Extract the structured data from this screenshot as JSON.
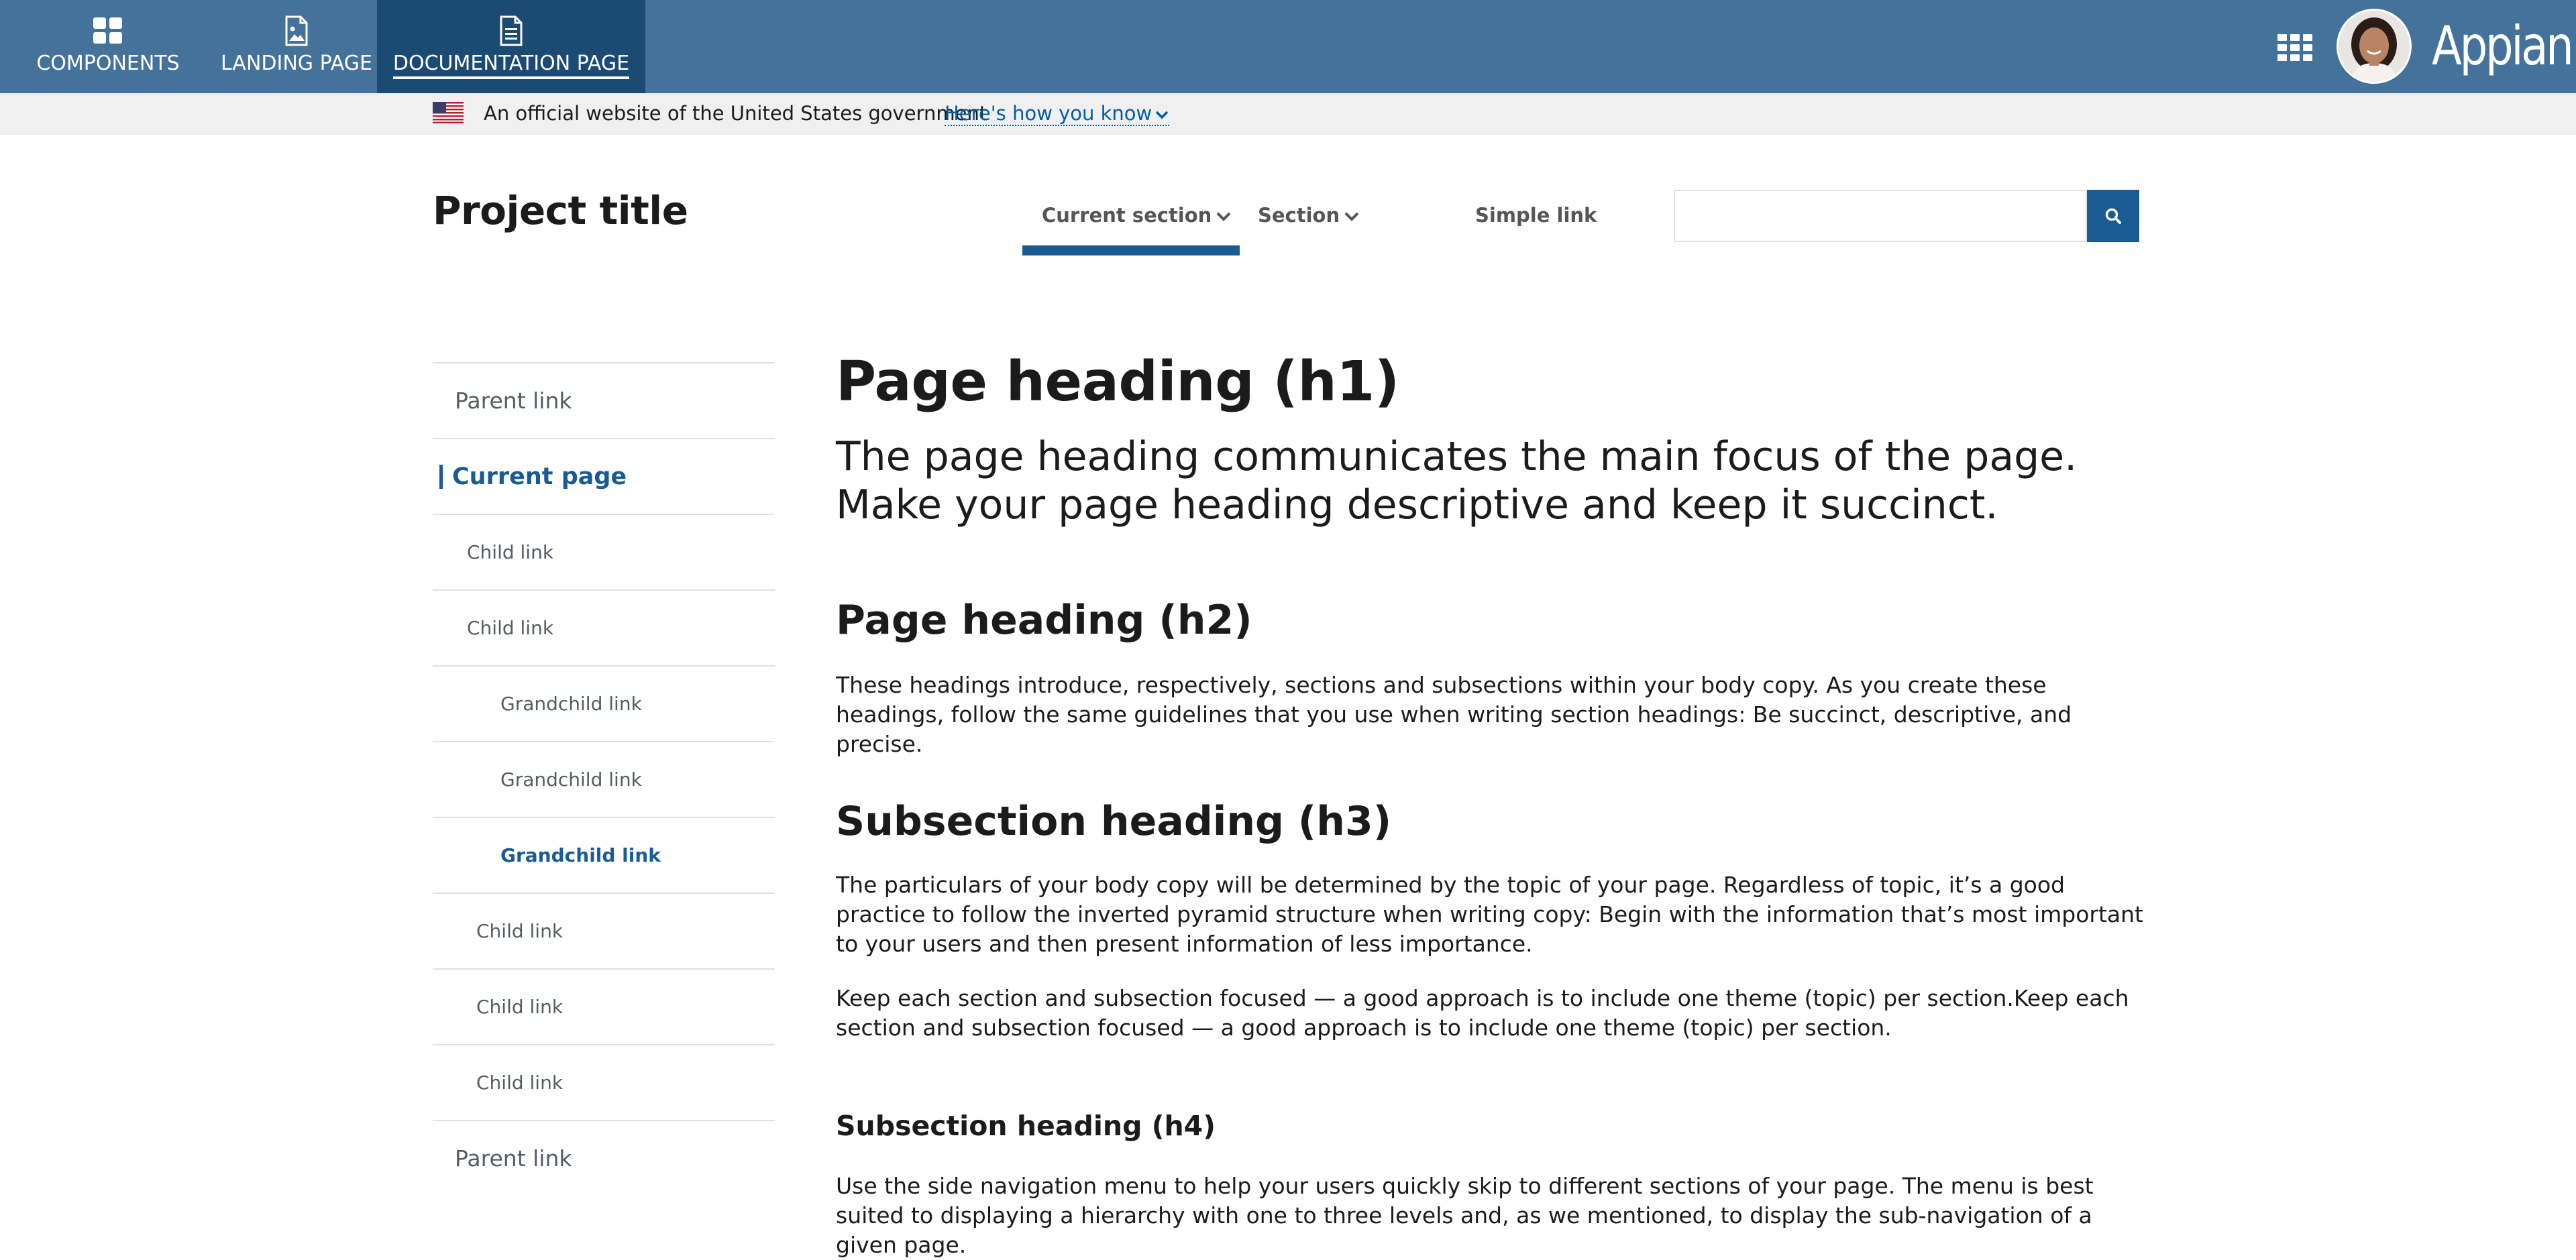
{
  "appbar": {
    "tabs": [
      {
        "label": "COMPONENTS",
        "icon": "components-grid-icon"
      },
      {
        "label": "LANDING PAGE",
        "icon": "image-document-icon"
      },
      {
        "label": "DOCUMENTATION PAGE",
        "icon": "document-icon",
        "active": true
      }
    ],
    "brand": "Appian",
    "apps_icon": "apps-grid-icon",
    "colors": {
      "bar": "#45729a",
      "active_tab": "#1b4a73"
    }
  },
  "gov_banner": {
    "text": "An official website of the United States government",
    "link": "Here's how you know"
  },
  "header": {
    "project_title": "Project title",
    "nav": [
      {
        "label": "Current section",
        "has_dropdown": true,
        "current": true
      },
      {
        "label": "Section",
        "has_dropdown": true
      },
      {
        "label": "Simple link"
      }
    ],
    "search": {
      "placeholder": "",
      "value": ""
    },
    "accent": "#1a5b93"
  },
  "sidenav": {
    "items": [
      {
        "label": "Parent link",
        "level": "parent"
      },
      {
        "label": "Current page",
        "level": "current"
      },
      {
        "label": "Child link",
        "level": "child"
      },
      {
        "label": "Child link",
        "level": "child"
      },
      {
        "label": "Grandchild link",
        "level": "grandchild"
      },
      {
        "label": "Grandchild link",
        "level": "grandchild"
      },
      {
        "label": "Grandchild link",
        "level": "grandchild",
        "active": true
      },
      {
        "label": "Child link",
        "level": "child"
      },
      {
        "label": "Child link",
        "level": "child"
      },
      {
        "label": "Child link",
        "level": "child"
      },
      {
        "label": "Parent link",
        "level": "parent"
      }
    ]
  },
  "content": {
    "h1": "Page heading (h1)",
    "lead": "The page heading communicates the main focus of the page. Make your page heading descriptive and keep it succinct.",
    "h2": "Page heading (h2)",
    "p1": "These headings introduce, respectively, sections and subsections within your body copy. As you create these headings, follow the same guidelines that you use when writing section headings: Be succinct, descriptive, and precise.",
    "h3": "Subsection heading (h3)",
    "p2": "The particulars of your body copy will be determined by the topic of your page. Regardless of topic, it’s a good practice to follow the inverted pyramid structure when writing copy: Begin with the information that’s most important to your users and then present information of less importance.",
    "p3": "Keep each section and subsection focused — a good approach is to include one theme (topic) per section.Keep each section and subsection focused — a good approach is to include one theme (topic) per section.",
    "h4": "Subsection heading (h4)",
    "p4": "Use the side navigation menu to help your users quickly skip to different sections of your page. The menu is best suited to displaying a hierarchy with one to three levels and, as we mentioned, to display the sub-navigation of a given page."
  }
}
